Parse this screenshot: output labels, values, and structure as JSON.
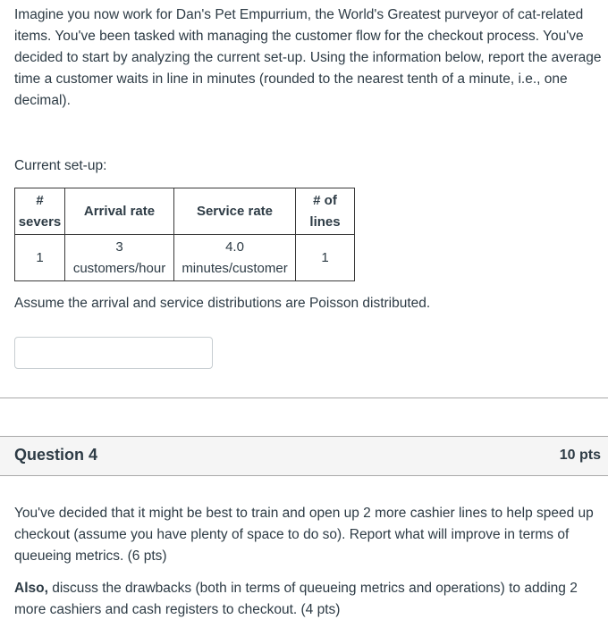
{
  "question3": {
    "intro": "Imagine you now work for Dan's Pet Empurrium, the World's Greatest purveyor of cat-related items. You've been tasked with managing the customer flow for the checkout process. You've decided to start by analyzing the current set-up. Using the information below, report the average time a customer waits in line in minutes (rounded to the nearest tenth of a minute, i.e., one decimal).",
    "setup_label": "Current set-up:",
    "table": {
      "headers": [
        {
          "line1": "#",
          "line2": "severs"
        },
        {
          "line1": "Arrival rate",
          "line2": ""
        },
        {
          "line1": "Service rate",
          "line2": ""
        },
        {
          "line1": "# of",
          "line2": "lines"
        }
      ],
      "row": [
        {
          "line1": "1",
          "line2": ""
        },
        {
          "line1": "3",
          "line2": "customers/hour"
        },
        {
          "line1": "4.0",
          "line2": "minutes/customer"
        },
        {
          "line1": "1",
          "line2": ""
        }
      ]
    },
    "assumption": "Assume the arrival and service distributions are Poisson distributed.",
    "answer": {
      "value": "",
      "placeholder": ""
    }
  },
  "question4": {
    "title": "Question 4",
    "points": "10 pts",
    "paragraph1": "You've decided that it might be best to train and open up 2 more cashier lines to help speed up checkout (assume you have plenty of space to do so). Report what will improve in terms of queueing metrics. (6 pts)",
    "paragraph2_bold": "Also,",
    "paragraph2_rest": " discuss the drawbacks (both in terms of queueing metrics and operations) to adding 2 more cashiers and cash registers to checkout. (4 pts)"
  }
}
